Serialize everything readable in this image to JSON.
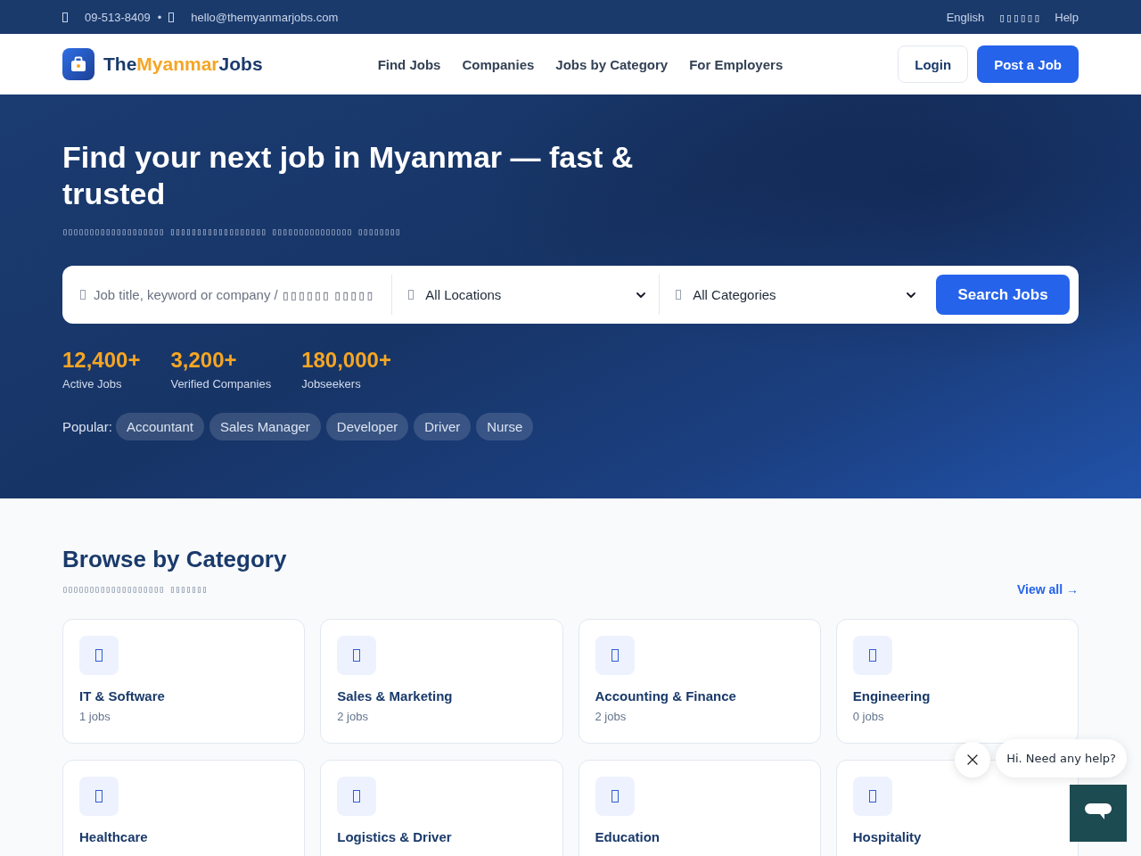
{
  "top_bar": {
    "phone": "09-513-8409",
    "separator": "•",
    "email": "hello@themyanmarjobs.com",
    "links": [
      "English",
      "▯▯▯▯▯▯",
      "Help"
    ]
  },
  "header": {
    "logo": [
      {
        "text": "The",
        "kind": "base"
      },
      {
        "text": "Myanmar",
        "kind": "accent"
      },
      {
        "text": "Jobs",
        "kind": "base"
      }
    ],
    "nav": [
      "Find Jobs",
      "Companies",
      "Jobs by Category",
      "For Employers"
    ],
    "buttons": [
      {
        "label": "Login",
        "kind": "outline"
      },
      {
        "label": "Post a Job",
        "kind": "primary"
      }
    ]
  },
  "hero": {
    "title": "Find your next job in Myanmar — fast & trusted",
    "subtitle": "▯▯▯▯▯▯▯▯▯▯▯▯▯▯▯▯▯▯▯ ▯▯▯▯▯▯▯▯▯▯▯▯▯▯▯▯▯▯ ▯▯▯▯▯▯▯▯▯▯▯▯▯▯▯ ▯▯▯▯▯▯▯▯",
    "search": {
      "keyword": {
        "placeholder": "Job title, keyword or company / ▯▯▯▯▯▯ ▯▯▯▯▯"
      },
      "location": {
        "value": "All Locations"
      },
      "category": {
        "value": "All Categories"
      },
      "button": "Search Jobs"
    },
    "stats": [
      {
        "value": "12,400+",
        "label": "Active Jobs"
      },
      {
        "value": "3,200+",
        "label": "Verified Companies"
      },
      {
        "value": "180,000+",
        "label": "Jobseekers"
      }
    ],
    "popular": {
      "label": "Popular:",
      "tags": [
        "Accountant",
        "Sales Manager",
        "Developer",
        "Driver",
        "Nurse"
      ]
    }
  },
  "categories": {
    "title": "Browse by Category",
    "subtitle": "▯▯▯▯▯▯▯▯▯▯▯▯▯▯▯▯▯▯▯ ▯▯▯▯▯▯▯",
    "view_all": "View all →",
    "items": [
      {
        "name": "IT & Software",
        "count": "1 jobs"
      },
      {
        "name": "Sales & Marketing",
        "count": "2 jobs"
      },
      {
        "name": "Accounting & Finance",
        "count": "2 jobs"
      },
      {
        "name": "Engineering",
        "count": "0 jobs"
      },
      {
        "name": "Healthcare"
      },
      {
        "name": "Logistics & Driver"
      },
      {
        "name": "Education"
      },
      {
        "name": "Hospitality"
      }
    ]
  },
  "chat": {
    "message": "Hi. Need any help?"
  }
}
